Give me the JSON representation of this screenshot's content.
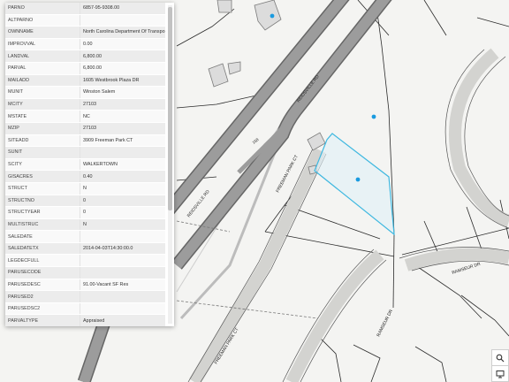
{
  "map": {
    "road_labels": [
      "REIDSVILLE RD",
      "REIDSVILLE RD",
      "FREEMAN PARK CT",
      "FREEMAN PARK CT",
      "RAMSEUR DR",
      "RAMSEUR DR",
      "158"
    ],
    "parcel_highlight_color": "#3fb8e0",
    "marker_color": "#1a9be0",
    "tools": [
      {
        "name": "search-icon"
      },
      {
        "name": "monitor-icon"
      }
    ]
  },
  "attributes": [
    {
      "key": "PARNO",
      "value": "6857-95-9308.00"
    },
    {
      "key": "ALTPARNO",
      "value": ""
    },
    {
      "key": "OWNNAME",
      "value": "North Carolina Department Of Transportation"
    },
    {
      "key": "IMPROVVAL",
      "value": "0.00"
    },
    {
      "key": "LANDVAL",
      "value": "6,800.00"
    },
    {
      "key": "PARVAL",
      "value": "6,800.00"
    },
    {
      "key": "MAILADD",
      "value": "1605 Westbrook Plaza DR"
    },
    {
      "key": "MUNIT",
      "value": "Winston Salem"
    },
    {
      "key": "MCITY",
      "value": "27103"
    },
    {
      "key": "MSTATE",
      "value": "NC"
    },
    {
      "key": "MZIP",
      "value": "27103"
    },
    {
      "key": "SITEADD",
      "value": "3909 Freeman Park CT"
    },
    {
      "key": "SUNIT",
      "value": ""
    },
    {
      "key": "SCITY",
      "value": "WALKERTOWN"
    },
    {
      "key": "GISACRES",
      "value": "0.40"
    },
    {
      "key": "STRUCT",
      "value": "N"
    },
    {
      "key": "STRUCTNO",
      "value": "0"
    },
    {
      "key": "STRUCTYEAR",
      "value": "0"
    },
    {
      "key": "MULTISTRUC",
      "value": "N"
    },
    {
      "key": "SALEDATE",
      "value": ""
    },
    {
      "key": "SALEDATETX",
      "value": "2014-04-03T14:30:00.0"
    },
    {
      "key": "LEGDECFULL",
      "value": ""
    },
    {
      "key": "PARUSECODE",
      "value": ""
    },
    {
      "key": "PARUSEDESC",
      "value": "91.00-Vacant SF Res"
    },
    {
      "key": "PARUSED2",
      "value": ""
    },
    {
      "key": "PARUSEDSC2",
      "value": ""
    },
    {
      "key": "PARVALTYPE",
      "value": "Appraised"
    },
    {
      "key": "OWNTYPE",
      "value": ""
    }
  ]
}
